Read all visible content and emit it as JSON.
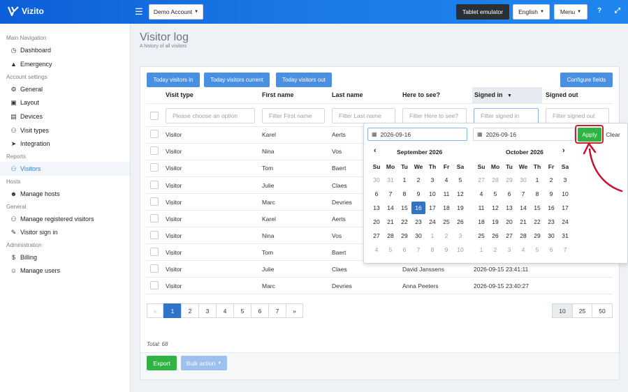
{
  "app": {
    "name": "Vizito"
  },
  "topbar": {
    "account_label": "Demo Account",
    "tablet_emulator_label": "Tablet emulator",
    "language_label": "English",
    "menu_label": "Menu"
  },
  "sidebar": {
    "sections": [
      {
        "title": "Main Navigation",
        "items": [
          {
            "label": "Dashboard",
            "icon": "dashboard-icon"
          },
          {
            "label": "Emergency",
            "icon": "warning-icon"
          }
        ]
      },
      {
        "title": "Account settings",
        "items": [
          {
            "label": "General",
            "icon": "gear-icon"
          },
          {
            "label": "Layout",
            "icon": "image-icon"
          },
          {
            "label": "Devices",
            "icon": "laptop-icon"
          },
          {
            "label": "Visit types",
            "icon": "users-icon"
          },
          {
            "label": "Integration",
            "icon": "rocket-icon"
          }
        ]
      },
      {
        "title": "Reports",
        "items": [
          {
            "label": "Visitors",
            "icon": "users-icon",
            "active": true
          }
        ]
      },
      {
        "title": "Hosts",
        "items": [
          {
            "label": "Manage hosts",
            "icon": "user-icon"
          }
        ]
      },
      {
        "title": "General",
        "items": [
          {
            "label": "Manage registered visitors",
            "icon": "users-icon"
          },
          {
            "label": "Visitor sign in",
            "icon": "pencil-icon"
          }
        ]
      },
      {
        "title": "Administration",
        "items": [
          {
            "label": "Billing",
            "icon": "dollar-icon"
          },
          {
            "label": "Manage users",
            "icon": "user-plus-icon"
          }
        ]
      }
    ]
  },
  "page": {
    "title": "Visitor log",
    "subtitle": "A history of all visitors"
  },
  "toolbar": {
    "today_in": "Today visitors in",
    "today_current": "Today visitors current",
    "today_out": "Today visitors out",
    "configure": "Configure fields"
  },
  "table": {
    "headers": [
      "Visit type",
      "First name",
      "Last name",
      "Here to see?",
      "Signed in",
      "Signed out"
    ],
    "filters": [
      "Please choose an option",
      "Filter First name",
      "Filter Last name",
      "Filter Here to see?",
      "Filter signed in",
      "Filter signed out"
    ],
    "rows": [
      {
        "type": "Visitor",
        "first": "Karel",
        "last": "Aerts",
        "here": "",
        "in": ""
      },
      {
        "type": "Visitor",
        "first": "Nina",
        "last": "Vos",
        "here": "",
        "in": ""
      },
      {
        "type": "Visitor",
        "first": "Tom",
        "last": "Baert",
        "here": "",
        "in": ""
      },
      {
        "type": "Visitor",
        "first": "Julie",
        "last": "Claes",
        "here": "",
        "in": ""
      },
      {
        "type": "Visitor",
        "first": "Marc",
        "last": "Devries",
        "here": "",
        "in": ""
      },
      {
        "type": "Visitor",
        "first": "Karel",
        "last": "Aerts",
        "here": "",
        "in": ""
      },
      {
        "type": "Visitor",
        "first": "Nina",
        "last": "Vos",
        "here": "",
        "in": ""
      },
      {
        "type": "Visitor",
        "first": "Tom",
        "last": "Baert",
        "here": "",
        "in": ""
      },
      {
        "type": "Visitor",
        "first": "Julie",
        "last": "Claes",
        "here": "David Janssens",
        "in": "2026-09-15 23:41:11"
      },
      {
        "type": "Visitor",
        "first": "Marc",
        "last": "Devries",
        "here": "Anna Peeters",
        "in": "2026-09-15 23:40:27"
      }
    ]
  },
  "datepicker": {
    "start_value": "2026-09-16",
    "end_value": "2026-09-16",
    "apply_label": "Apply",
    "clear_label": "Clear",
    "weekdays": [
      "Su",
      "Mo",
      "Tu",
      "We",
      "Th",
      "Fr",
      "Sa"
    ],
    "left": {
      "title": "September 2026",
      "days": [
        [
          "30",
          "31",
          "1",
          "2",
          "3",
          "4",
          "5"
        ],
        [
          "6",
          "7",
          "8",
          "9",
          "10",
          "11",
          "12"
        ],
        [
          "13",
          "14",
          "15",
          "16",
          "17",
          "18",
          "19"
        ],
        [
          "20",
          "21",
          "22",
          "23",
          "24",
          "25",
          "26"
        ],
        [
          "27",
          "28",
          "29",
          "30",
          "1",
          "2",
          "3"
        ],
        [
          "4",
          "5",
          "6",
          "7",
          "8",
          "9",
          "10"
        ]
      ],
      "muted": [
        [
          0,
          0
        ],
        [
          0,
          1
        ],
        [
          4,
          4
        ],
        [
          4,
          5
        ],
        [
          4,
          6
        ],
        [
          5,
          0
        ],
        [
          5,
          1
        ],
        [
          5,
          2
        ],
        [
          5,
          3
        ],
        [
          5,
          4
        ],
        [
          5,
          5
        ],
        [
          5,
          6
        ]
      ],
      "selected": [
        2,
        3
      ]
    },
    "right": {
      "title": "October 2026",
      "days": [
        [
          "27",
          "28",
          "29",
          "30",
          "1",
          "2",
          "3"
        ],
        [
          "4",
          "5",
          "6",
          "7",
          "8",
          "9",
          "10"
        ],
        [
          "11",
          "12",
          "13",
          "14",
          "15",
          "16",
          "17"
        ],
        [
          "18",
          "19",
          "20",
          "21",
          "22",
          "23",
          "24"
        ],
        [
          "25",
          "26",
          "27",
          "28",
          "29",
          "30",
          "31"
        ],
        [
          "1",
          "2",
          "3",
          "4",
          "5",
          "6",
          "7"
        ]
      ],
      "muted": [
        [
          0,
          0
        ],
        [
          0,
          1
        ],
        [
          0,
          2
        ],
        [
          0,
          3
        ],
        [
          5,
          0
        ],
        [
          5,
          1
        ],
        [
          5,
          2
        ],
        [
          5,
          3
        ],
        [
          5,
          4
        ],
        [
          5,
          5
        ],
        [
          5,
          6
        ]
      ]
    }
  },
  "pagination": {
    "prev": "«",
    "pages": [
      "1",
      "2",
      "3",
      "4",
      "5",
      "6",
      "7"
    ],
    "next": "»",
    "current": "1",
    "sizes": [
      "10",
      "25",
      "50"
    ],
    "current_size": "10"
  },
  "footer": {
    "total": "Total: 68",
    "export": "Export",
    "bulk_action": "Bulk action"
  },
  "colors": {
    "primary": "#2f74c9",
    "topbar": "#1b7ae6",
    "success": "#2fb344",
    "highlight": "#d21d2b"
  }
}
